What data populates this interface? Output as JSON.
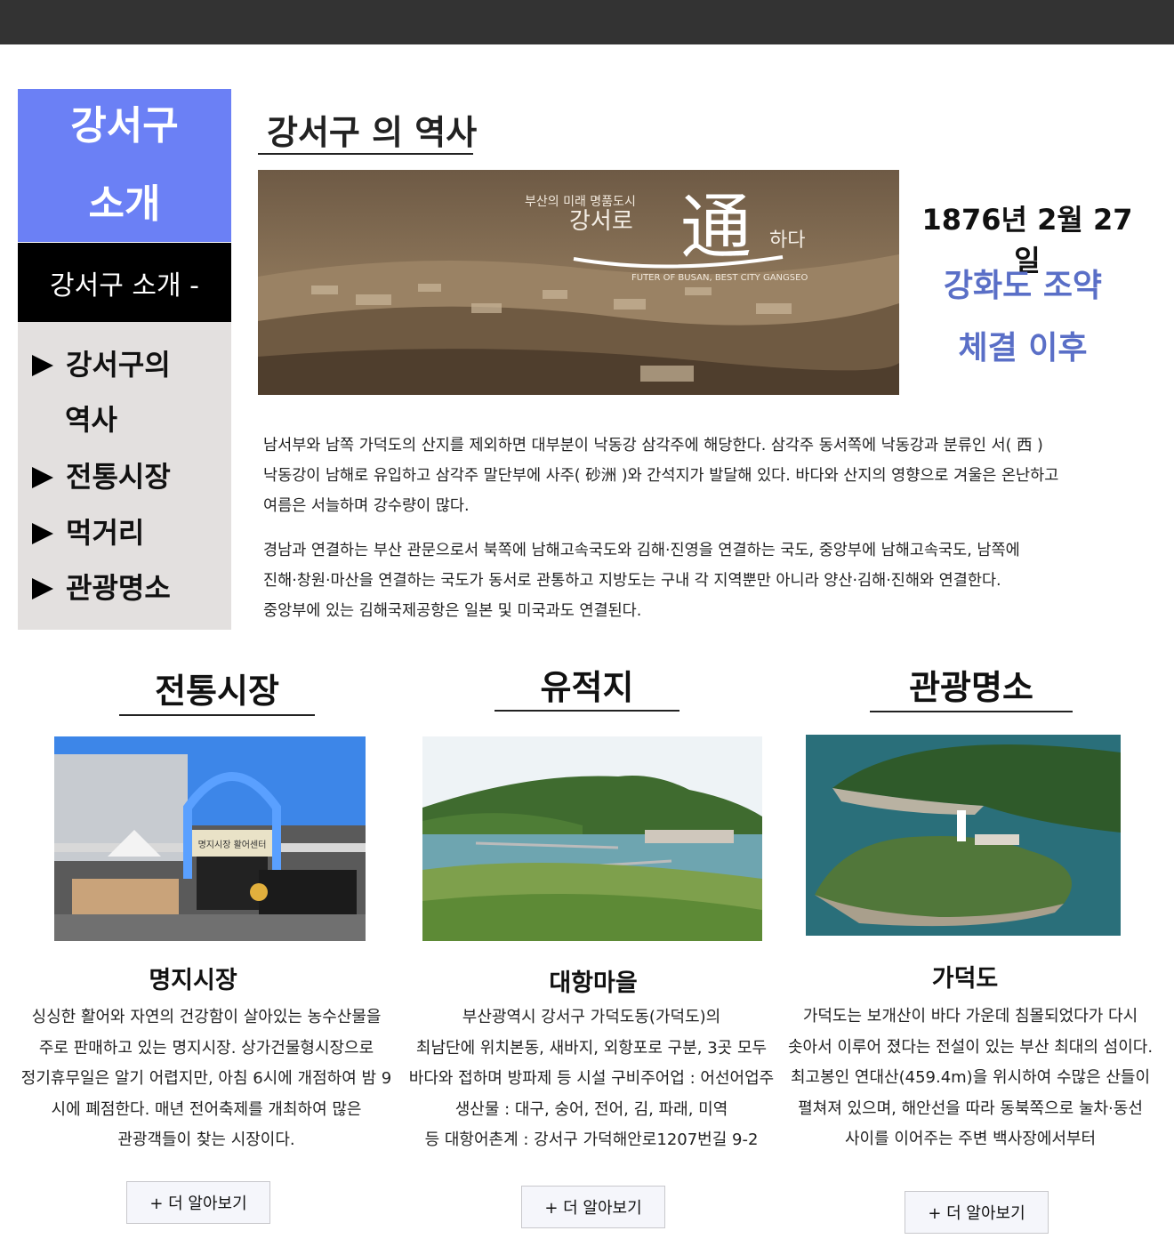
{
  "sidebar": {
    "title_line1": "강서구",
    "title_line2": "소개",
    "subtitle": "강서구 소개 -",
    "items": [
      {
        "label_line1": "강서구의",
        "label_line2": "역사"
      },
      {
        "label_line1": "전통시장"
      },
      {
        "label_line1": "먹거리"
      },
      {
        "label_line1": "관광명소"
      }
    ]
  },
  "history": {
    "heading": "강서구 의 역사",
    "hero": {
      "line1": "부산의 미래 명품도시",
      "line2_left": "강서로",
      "line2_char": "通",
      "line2_right": "하다",
      "line3": "FUTER OF BUSAN, BEST CITY GANGSEO"
    },
    "date": "1876년 2월 27일",
    "treaty_line1": "강화도 조약",
    "treaty_line2": "체결 이후",
    "paragraph1": [
      "남서부와 남쪽 가덕도의 산지를 제외하면 대부분이 낙동강 삼각주에 해당한다. 삼각주 동서쪽에 낙동강과 분류인 서( 西 )",
      "낙동강이 남해로 유입하고 삼각주 말단부에 사주( 砂洲 )와 간석지가 발달해 있다. 바다와 산지의 영향으로 겨울은 온난하고",
      "여름은 서늘하며 강수량이 많다."
    ],
    "paragraph2": [
      "경남과 연결하는 부산 관문으로서 북쪽에 남해고속국도와 김해·진영을 연결하는 국도, 중앙부에 남해고속국도, 남쪽에",
      "진해·창원·마산을 연결하는 국도가 동서로 관통하고 지방도는 구내 각 지역뿐만 아니라 양산·김해·진해와 연결한다.",
      "중앙부에 있는 김해국제공항은 일본 및 미국과도 연결된다."
    ]
  },
  "sections": [
    {
      "title": "전통시장",
      "name": "명지시장",
      "desc": [
        "싱싱한 활어와 자연의 건강함이 살아있는 농수산물을",
        "주로 판매하고 있는 명지시장. 상가건물형시장으로",
        "정기휴무일은 알기 어렵지만, 아침 6시에 개점하여 밤 9",
        "시에 폐점한다. 매년 전어축제를 개최하여 많은",
        "관광객들이 찾는 시장이다."
      ],
      "sign": "명지시장 활어센터",
      "button": "+ 더 알아보기"
    },
    {
      "title": "유적지",
      "name": "대항마을",
      "desc": [
        "부산광역시 강서구 가덕도동(가덕도)의",
        "최남단에 위치본동, 새바지, 외항포로 구분, 3곳 모두",
        "바다와 접하며 방파제 등 시설 구비주어업 : 어선어업주",
        "생산물 : 대구, 숭어, 전어, 김, 파래, 미역",
        "등 대항어촌계 : 강서구 가덕해안로1207번길 9-2"
      ],
      "button": "+ 더 알아보기"
    },
    {
      "title": "관광명소",
      "name": "가덕도",
      "desc": [
        "가덕도는 보개산이 바다 가운데 침몰되었다가 다시",
        "솟아서 이루어 졌다는 전설이 있는 부산 최대의 섬이다.",
        "최고봉인 연대산(459.4m)을 위시하여 수많은 산들이",
        "펼쳐져 있으며, 해안선을 따라 동북쪽으로 눌차·동선",
        "사이를 이어주는 주변 백사장에서부터"
      ],
      "button": "+ 더 알아보기"
    }
  ]
}
